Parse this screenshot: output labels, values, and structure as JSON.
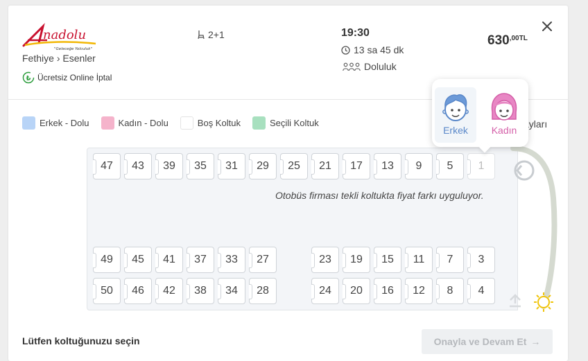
{
  "header": {
    "brand_name": "Anadolu",
    "brand_slogan": "\"Geleceğe Yolculuk\"",
    "route_from": "Fethiye",
    "route_to": "Esenler",
    "route_separator": "›",
    "cancel_text": "Ücretsiz Online İptal",
    "seat_layout": "2+1",
    "departure_time": "19:30",
    "duration": "13 sa 45 dk",
    "occupancy_label": "Doluluk",
    "price_main": "630",
    "price_decimal": ",00TL",
    "close_icon": "close-icon"
  },
  "legend": [
    {
      "label": "Erkek - Dolu",
      "color": "#b8d4f7"
    },
    {
      "label": "Kadın - Dolu",
      "color": "#f5b3cb"
    },
    {
      "label": "Boş Koltuk",
      "color": "#ffffff"
    },
    {
      "label": "Seçili Koltuk",
      "color": "#a8e0bf"
    }
  ],
  "legend_extra": "ayları",
  "notice": "Otobüs firması tekli koltukta fiyat farkı uyguluyor.",
  "seats": {
    "top_row": [
      "47",
      "43",
      "39",
      "35",
      "31",
      "29",
      "25",
      "21",
      "17",
      "13",
      "9",
      "5",
      "1"
    ],
    "middle_row_left": [
      "49",
      "45",
      "41",
      "37",
      "33",
      "27"
    ],
    "middle_row_right": [
      "23",
      "19",
      "15",
      "11",
      "7",
      "3"
    ],
    "bottom_row_left": [
      "50",
      "46",
      "42",
      "38",
      "34",
      "28"
    ],
    "bottom_row_right": [
      "24",
      "20",
      "16",
      "12",
      "8",
      "4"
    ],
    "selected_seat": "1"
  },
  "gender_popup": {
    "male_label": "Erkek",
    "female_label": "Kadın"
  },
  "footer": {
    "prompt": "Lütfen koltuğunuzu seçin",
    "confirm_label": "Onayla ve Devam Et",
    "confirm_arrow": "→"
  },
  "colors": {
    "accent_red": "#c8102e",
    "male_blue": "#5a88c9",
    "female_pink": "#d45fa8",
    "cancel_green": "#2e9e3e"
  }
}
